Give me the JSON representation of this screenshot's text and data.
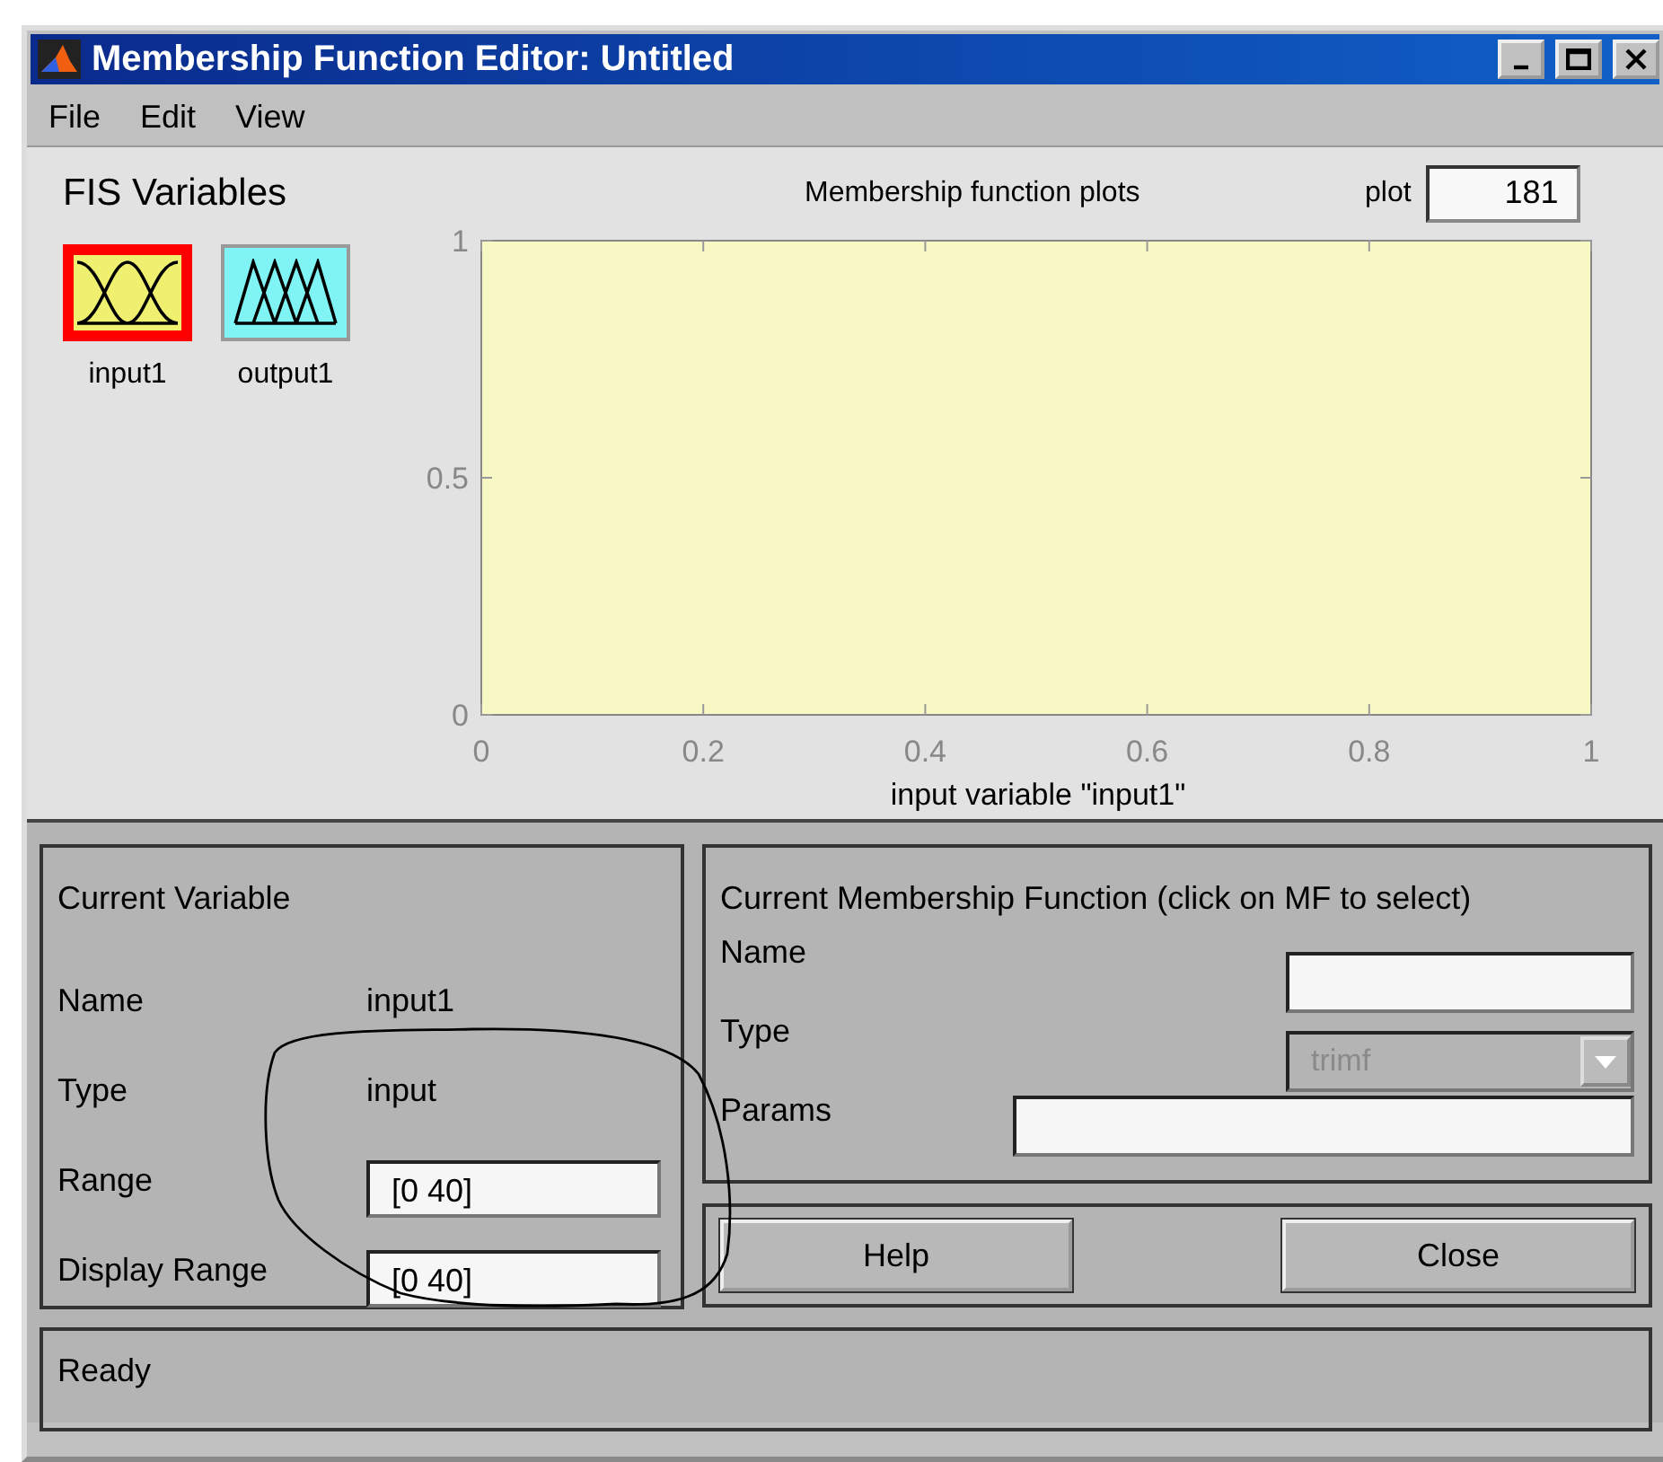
{
  "window": {
    "title": "Membership Function Editor: Untitled"
  },
  "menu": [
    "File",
    "Edit",
    "View"
  ],
  "fis_variables": {
    "title": "FIS Variables",
    "items": [
      {
        "label": "input1",
        "kind": "input",
        "selected": true
      },
      {
        "label": "output1",
        "kind": "output",
        "selected": false
      }
    ]
  },
  "plot": {
    "title": "Membership function plots",
    "points_label": "plot",
    "points_value": "181",
    "chart_data": {
      "type": "line",
      "xlabel": "input variable \"input1\"",
      "xlim": [
        0,
        1
      ],
      "ylim": [
        0,
        1
      ],
      "xticks": [
        0,
        0.2,
        0.4,
        0.6,
        0.8,
        1
      ],
      "yticks": [
        0,
        0.5,
        1
      ]
    }
  },
  "current_variable": {
    "title": "Current Variable",
    "rows": [
      {
        "label": "Name",
        "kind": "text",
        "value": "input1"
      },
      {
        "label": "Type",
        "kind": "text",
        "value": "input"
      },
      {
        "label": "Range",
        "kind": "field",
        "value": "[0 40]"
      },
      {
        "label": "Display Range",
        "kind": "field",
        "value": "[0 40]"
      }
    ]
  },
  "current_mf": {
    "title": "Current Membership Function (click on MF to select)",
    "name_label": "Name",
    "type_label": "Type",
    "type_value": "trimf",
    "type_disabled": true,
    "params_label": "Params"
  },
  "buttons": [
    "Help",
    "Close"
  ],
  "status_bar": "Ready"
}
